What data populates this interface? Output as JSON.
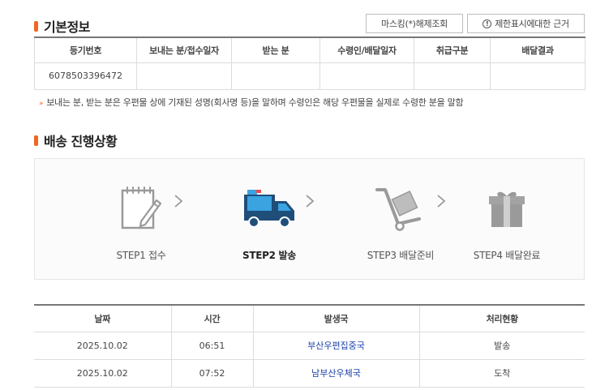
{
  "basic_info": {
    "title": "기본정보",
    "buttons": {
      "masking": "마스킹(*)해제조회",
      "restriction_icon": "!",
      "restriction": "제한표시에대한 근거"
    },
    "columns": [
      "등기번호",
      "보내는 분/접수일자",
      "받는 분",
      "수령인/배달일자",
      "취급구분",
      "배달결과"
    ],
    "row": [
      "6078503396472",
      "",
      "",
      "",
      "",
      ""
    ],
    "note_arrow": "»",
    "note": "보내는 분, 받는 분은 우편물 상에 기재된 성명(회사명 등)을 말하며 수령인은 해당 우편물을 실제로 수령한 분을 말함"
  },
  "delivery": {
    "title": "배송 진행상황",
    "steps": [
      {
        "label": "STEP1 접수",
        "icon": "notepad-pencil-icon",
        "active": false
      },
      {
        "label": "STEP2 발송",
        "icon": "truck-icon",
        "active": true
      },
      {
        "label": "STEP3 배달준비",
        "icon": "hand-cart-icon",
        "active": false
      },
      {
        "label": "STEP4 배달완료",
        "icon": "gift-box-icon",
        "active": false
      }
    ]
  },
  "history": {
    "columns": [
      "날짜",
      "시간",
      "발생국",
      "처리현황"
    ],
    "rows": [
      [
        "2025.10.02",
        "06:51",
        "부산우편집중국",
        "발송"
      ],
      [
        "2025.10.02",
        "07:52",
        "남부산우체국",
        "도착"
      ]
    ]
  },
  "colors": {
    "accent": "#f26522",
    "link": "#1a3fa8",
    "truck_body": "#1f4e79",
    "truck_cargo": "#3aa3e0",
    "icon_gray": "#9a9a9a"
  }
}
